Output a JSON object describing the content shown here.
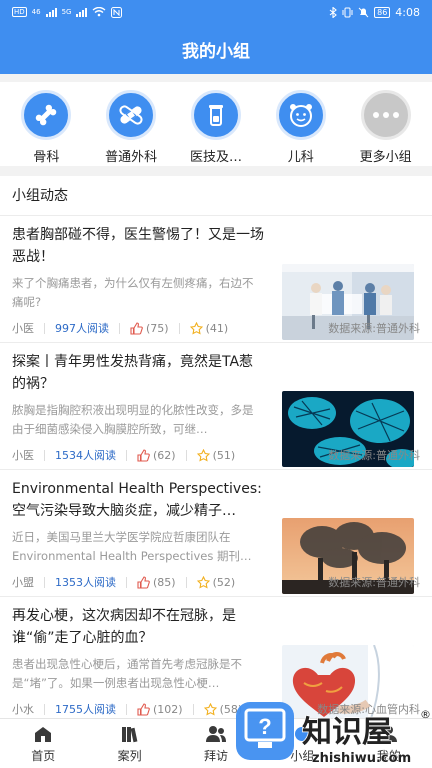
{
  "statusbar": {
    "left": [
      "HD",
      "46",
      "5G"
    ],
    "battery": "86",
    "time": "4:08"
  },
  "header": {
    "title": "我的小组"
  },
  "groups": [
    {
      "label": "骨科",
      "icon": "bone-icon"
    },
    {
      "label": "普通外科",
      "icon": "bandage-icon"
    },
    {
      "label": "医技及…",
      "icon": "lab-beaker-icon"
    },
    {
      "label": "儿科",
      "icon": "baby-face-icon"
    },
    {
      "label": "更多小组",
      "icon": "more-dots-icon"
    }
  ],
  "feed": {
    "section_title": "小组动态",
    "articles": [
      {
        "title": "患者胸部碰不得，医生警惕了！又是一场恶战！",
        "summary": "来了个胸痛患者，为什么仅有左侧疼痛，右边不痛呢?",
        "author": "小医",
        "reads": "997人阅读",
        "likes": "(75)",
        "stars": "(41)",
        "source": "数据来源:普通外科",
        "image": "hospital-corridor-photo"
      },
      {
        "title": "探案丨青年男性发热背痛，竟然是TA惹的祸？",
        "summary": "脓胸是指胸腔积液出现明显的化脓性改变，多是由于细菌感染侵入胸膜腔所致，可继…",
        "author": "小医",
        "reads": "1534人阅读",
        "likes": "(62)",
        "stars": "(51)",
        "source": "数据来源:普通外科",
        "image": "bacteria-photo"
      },
      {
        "title": "Environmental Health Perspectives: 空气污染导致大脑炎症，减少精子…",
        "summary": "近日，美国马里兰大学医学院应哲康团队在Environmental Health Perspectives 期刊…",
        "author": "小盟",
        "reads": "1353人阅读",
        "likes": "(85)",
        "stars": "(52)",
        "source": "数据来源:普通外科",
        "image": "smokestack-pollution-photo"
      },
      {
        "title": "再发心梗，这次病因却不在冠脉，是谁“偷”走了心脏的血？",
        "summary": "患者出现急性心梗后，通常首先考虑冠脉是不是“堵”了。如果一例患者出现急性心梗…",
        "author": "小水",
        "reads": "1755人阅读",
        "likes": "(102)",
        "stars": "(58)",
        "source": "数据来源:心血管内科",
        "image": "heart-model-photo"
      }
    ]
  },
  "tabbar": [
    {
      "label": "首页",
      "icon": "home-icon"
    },
    {
      "label": "案列",
      "icon": "books-icon"
    },
    {
      "label": "拜访",
      "icon": "people-icon"
    },
    {
      "label": "小组",
      "icon": "group-icon"
    },
    {
      "label": "我的",
      "icon": "user-icon"
    }
  ],
  "watermark": {
    "brand": "知识屋",
    "url": "zhishiwu.com"
  },
  "colors": {
    "brand_blue": "#3f8ef0",
    "reads_blue": "#2e6bc7",
    "like_red": "#e05a4e",
    "star_yellow": "#f2b01e"
  }
}
